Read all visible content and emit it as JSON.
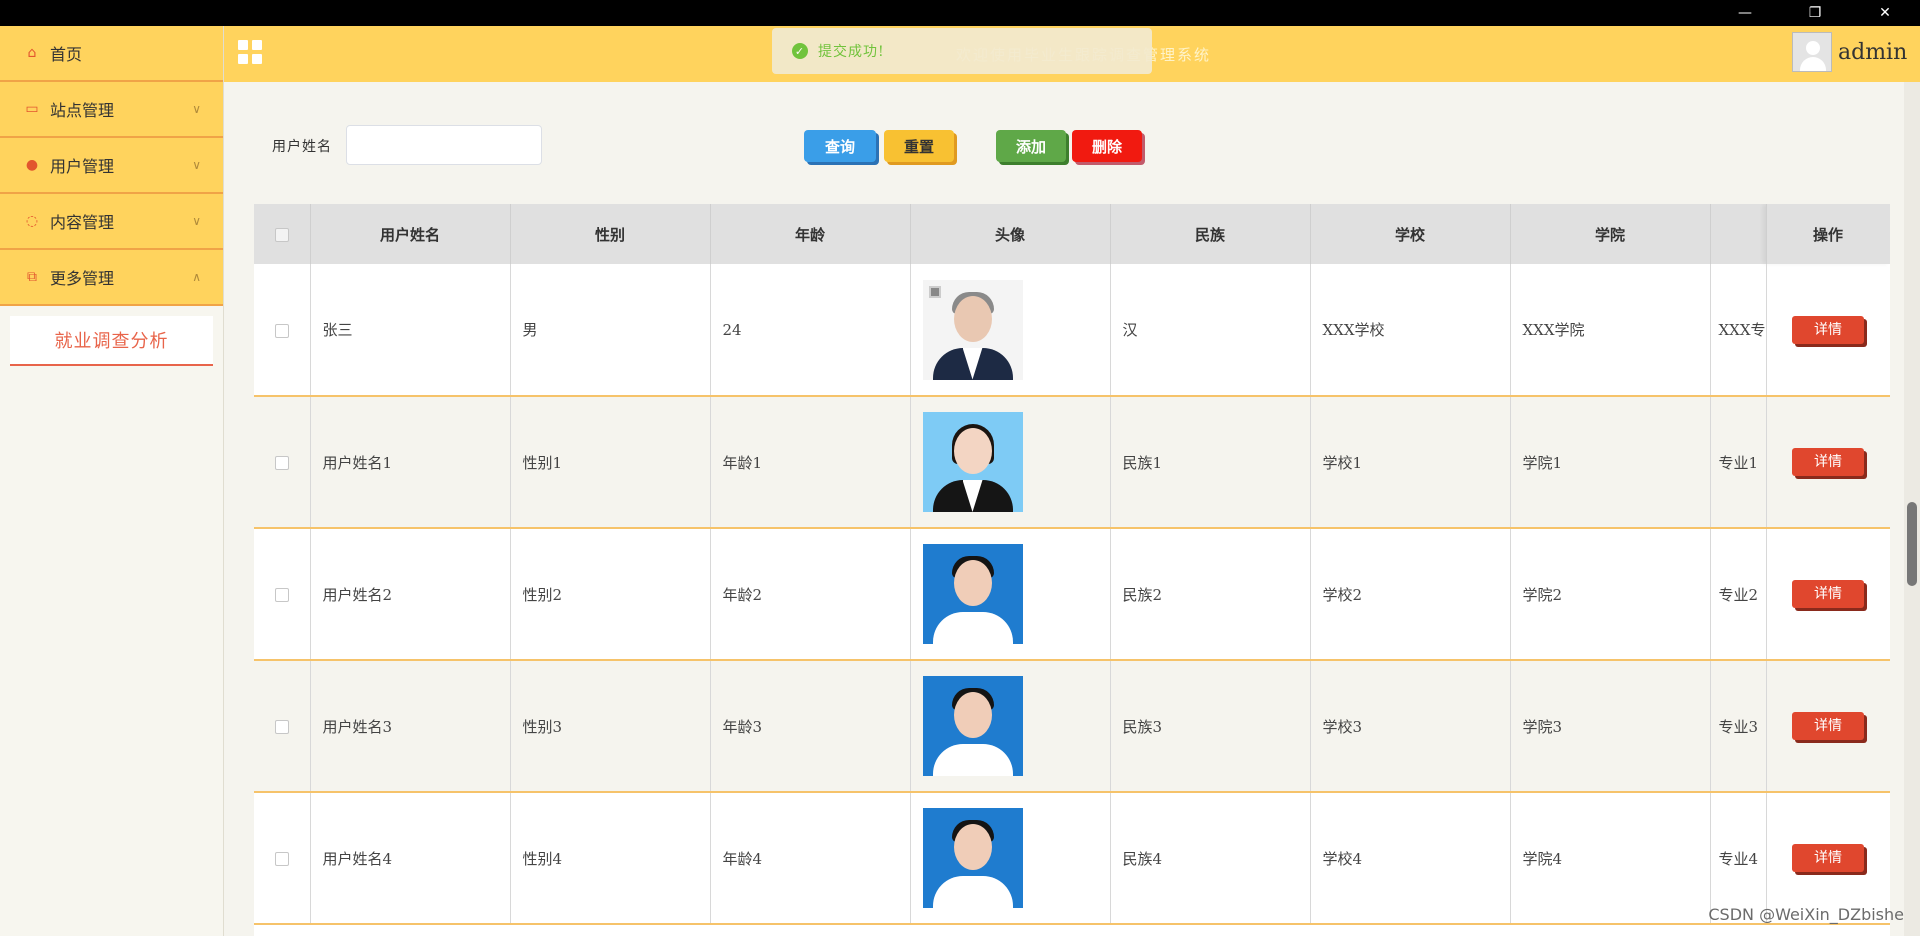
{
  "window": {
    "minimize_glyph": "—",
    "maximize_glyph": "❐",
    "close_glyph": "✕"
  },
  "sidebar": {
    "items": [
      {
        "label": "首页",
        "icon": "home-icon",
        "glyph": "⌂"
      },
      {
        "label": "站点管理",
        "icon": "monitor-icon",
        "glyph": "▭",
        "chevron": "∨"
      },
      {
        "label": "用户管理",
        "icon": "user-icon",
        "glyph": "●",
        "chevron": "∨"
      },
      {
        "label": "内容管理",
        "icon": "chat-icon",
        "glyph": "◌",
        "chevron": "∨"
      },
      {
        "label": "更多管理",
        "icon": "copy-icon",
        "glyph": "⧉",
        "chevron": "∧"
      }
    ],
    "submenu": [
      {
        "label": "就业调查分析"
      }
    ]
  },
  "header": {
    "welcome": "欢迎使用毕业生跟踪调查管理系统",
    "username": "admin",
    "toast": "提交成功!"
  },
  "search": {
    "label": "用户姓名",
    "placeholder": "",
    "buttons": {
      "query": "查询",
      "reset": "重置",
      "add": "添加",
      "delete": "删除"
    }
  },
  "table": {
    "columns": [
      "用户姓名",
      "性别",
      "年龄",
      "头像",
      "民族",
      "学校",
      "学院",
      "",
      "操作"
    ],
    "rows": [
      {
        "name": "张三",
        "gender": "男",
        "age": "24",
        "ethnic": "汉",
        "school": "XXX学校",
        "college": "XXX学院",
        "major": "XXX专",
        "action": "详情"
      },
      {
        "name": "用户姓名1",
        "gender": "性别1",
        "age": "年龄1",
        "ethnic": "民族1",
        "school": "学校1",
        "college": "学院1",
        "major": "专业1",
        "action": "详情"
      },
      {
        "name": "用户姓名2",
        "gender": "性别2",
        "age": "年龄2",
        "ethnic": "民族2",
        "school": "学校2",
        "college": "学院2",
        "major": "专业2",
        "action": "详情"
      },
      {
        "name": "用户姓名3",
        "gender": "性别3",
        "age": "年龄3",
        "ethnic": "民族3",
        "school": "学校3",
        "college": "学院3",
        "major": "专业3",
        "action": "详情"
      },
      {
        "name": "用户姓名4",
        "gender": "性别4",
        "age": "年龄4",
        "ethnic": "民族4",
        "school": "学校4",
        "college": "学院4",
        "major": "专业4",
        "action": "详情"
      }
    ]
  },
  "watermark": "CSDN @WeiXin_DZbishe",
  "colors": {
    "theme_yellow": "#ffd35d",
    "accent_red": "#e0472e",
    "row_divider": "#f6c36a"
  }
}
